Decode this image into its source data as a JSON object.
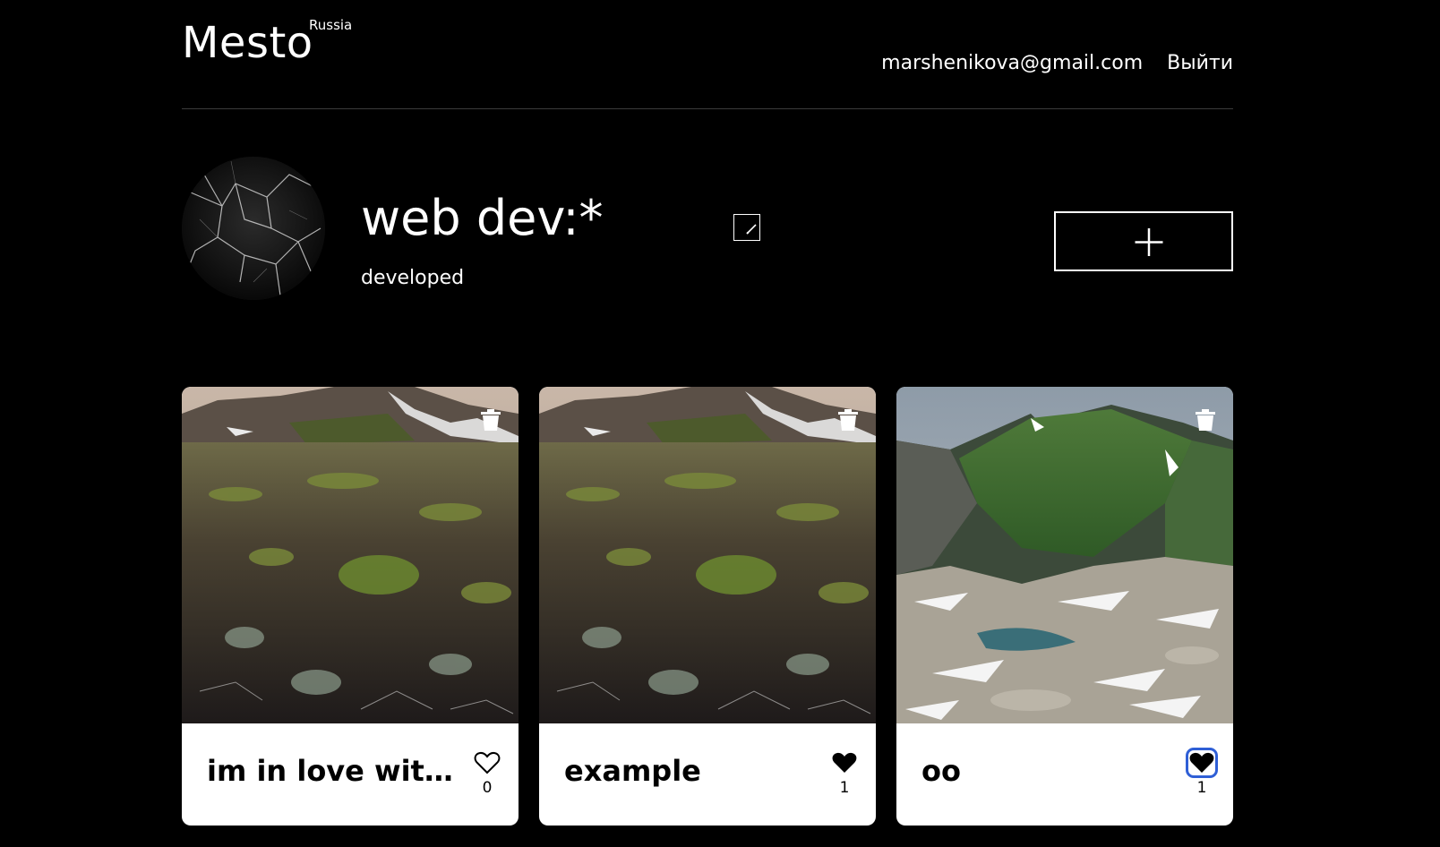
{
  "header": {
    "logo": "Mesto",
    "region": "Russia",
    "email": "marshenikova@gmail.com",
    "logout_label": "Выйти"
  },
  "profile": {
    "name": "web dev:*",
    "about": "developed",
    "edit_icon": "pencil-icon",
    "add_icon": "plus-icon"
  },
  "cards": [
    {
      "title": "im in love with m…",
      "likes": "0",
      "liked": false,
      "image": "tundra-field"
    },
    {
      "title": "example",
      "likes": "1",
      "liked": true,
      "image": "tundra-field"
    },
    {
      "title": "oo",
      "likes": "1",
      "liked": true,
      "focused": true,
      "image": "green-mountain-valley"
    }
  ],
  "colors": {
    "background": "#000000",
    "card": "#ffffff",
    "focus_ring": "#2f5fd6"
  }
}
